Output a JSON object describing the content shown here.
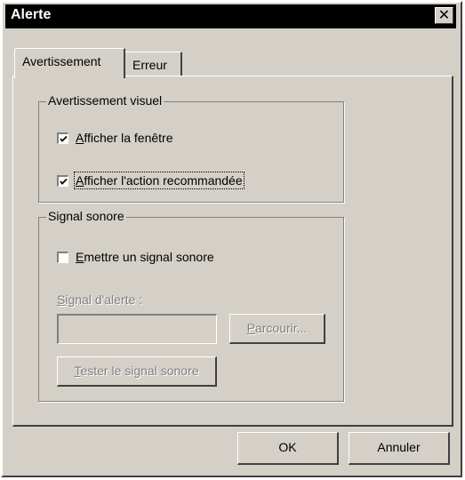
{
  "window": {
    "title": "Alerte",
    "close_glyph": "✕"
  },
  "tabs": [
    {
      "label": "Avertissement",
      "active": true
    },
    {
      "label": "Erreur",
      "active": false
    }
  ],
  "visual_group": {
    "legend": "Avertissement visuel",
    "show_window": {
      "accel": "A",
      "rest": "fficher la fenêtre",
      "checked": true
    },
    "show_action": {
      "accel": "A",
      "rest": "fficher l'action recommandée",
      "checked": true
    }
  },
  "sound_group": {
    "legend": "Signal sonore",
    "emit_sound": {
      "accel": "E",
      "rest": "mettre un signal sonore",
      "checked": false
    },
    "signal_label": {
      "accel": "S",
      "rest": "ignal d'alerte :"
    },
    "signal_value": "",
    "browse_button": {
      "accel": "P",
      "rest": "arcourir..."
    },
    "test_button": {
      "accel": "T",
      "rest": "ester le signal sonore"
    }
  },
  "buttons": {
    "ok": "OK",
    "cancel": "Annuler"
  }
}
